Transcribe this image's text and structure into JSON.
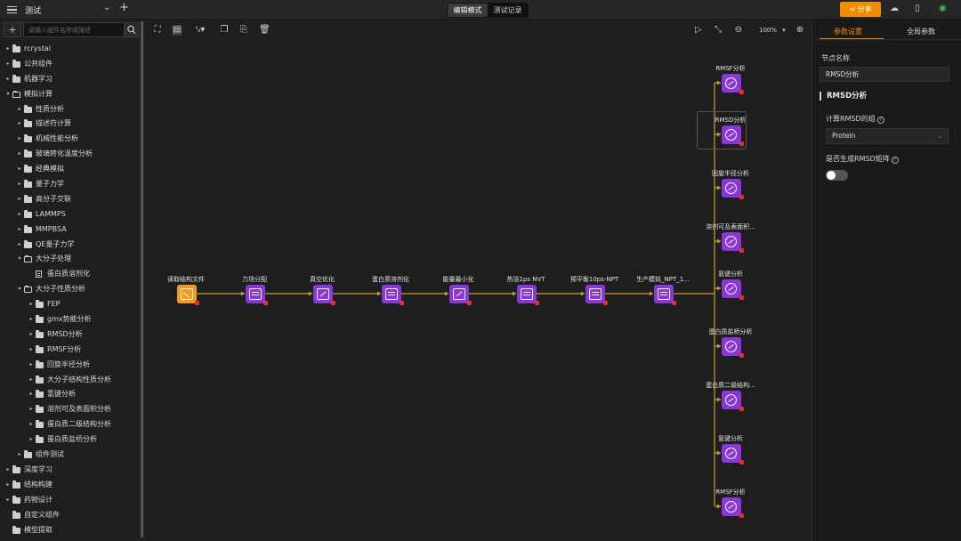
{
  "topbar": {
    "project_title": "测试",
    "modes": [
      {
        "label": "编辑模式",
        "active": true
      },
      {
        "label": "测试记录",
        "active": false
      }
    ],
    "share_label": "分享",
    "accent": "#f08c00"
  },
  "sidebar": {
    "search_placeholder": "请输入组件名称或描述",
    "tree": [
      {
        "label": "rcrystal",
        "depth": 0,
        "type": "folder",
        "expanded": false
      },
      {
        "label": "公共组件",
        "depth": 0,
        "type": "folder",
        "expanded": false
      },
      {
        "label": "机器学习",
        "depth": 0,
        "type": "folder",
        "expanded": false
      },
      {
        "label": "模拟计算",
        "depth": 0,
        "type": "folder",
        "expanded": true
      },
      {
        "label": "性质分析",
        "depth": 1,
        "type": "folder",
        "expanded": false
      },
      {
        "label": "描述符计算",
        "depth": 1,
        "type": "folder",
        "expanded": false
      },
      {
        "label": "机械性能分析",
        "depth": 1,
        "type": "folder",
        "expanded": false
      },
      {
        "label": "玻璃转化温度分析",
        "depth": 1,
        "type": "folder",
        "expanded": false
      },
      {
        "label": "经典模拟",
        "depth": 1,
        "type": "folder",
        "expanded": false
      },
      {
        "label": "量子力学",
        "depth": 1,
        "type": "folder",
        "expanded": false
      },
      {
        "label": "高分子交联",
        "depth": 1,
        "type": "folder",
        "expanded": false
      },
      {
        "label": "LAMMPS",
        "depth": 1,
        "type": "folder",
        "expanded": false
      },
      {
        "label": "MMPBSA",
        "depth": 1,
        "type": "folder",
        "expanded": false
      },
      {
        "label": "QE量子力学",
        "depth": 1,
        "type": "folder",
        "expanded": false
      },
      {
        "label": "大分子处理",
        "depth": 1,
        "type": "folder",
        "expanded": true
      },
      {
        "label": "蛋白质溶剂化",
        "depth": 2,
        "type": "file",
        "expanded": false
      },
      {
        "label": "大分子性质分析",
        "depth": 1,
        "type": "folder",
        "expanded": true
      },
      {
        "label": "FEP",
        "depth": 2,
        "type": "folder",
        "expanded": false
      },
      {
        "label": "gmx势能分析",
        "depth": 2,
        "type": "folder",
        "expanded": false
      },
      {
        "label": "RMSD分析",
        "depth": 2,
        "type": "folder",
        "expanded": false
      },
      {
        "label": "RMSF分析",
        "depth": 2,
        "type": "folder",
        "expanded": false
      },
      {
        "label": "回旋半径分析",
        "depth": 2,
        "type": "folder",
        "expanded": false
      },
      {
        "label": "大分子结构性质分析",
        "depth": 2,
        "type": "folder",
        "expanded": false
      },
      {
        "label": "氢键分析",
        "depth": 2,
        "type": "folder",
        "expanded": false
      },
      {
        "label": "溶剂可及表面积分析",
        "depth": 2,
        "type": "folder",
        "expanded": false
      },
      {
        "label": "蛋白质二级结构分析",
        "depth": 2,
        "type": "folder",
        "expanded": false
      },
      {
        "label": "蛋白质盐桥分析",
        "depth": 2,
        "type": "folder",
        "expanded": false
      },
      {
        "label": "组件测试",
        "depth": 1,
        "type": "folder",
        "expanded": false
      },
      {
        "label": "深度学习",
        "depth": 0,
        "type": "folder",
        "expanded": false
      },
      {
        "label": "结构构建",
        "depth": 0,
        "type": "folder",
        "expanded": false
      },
      {
        "label": "药物设计",
        "depth": 0,
        "type": "folder",
        "expanded": false
      },
      {
        "label": "自定义组件",
        "depth": 0,
        "type": "folder",
        "expanded": false,
        "no_caret": true
      },
      {
        "label": "模型提取",
        "depth": 0,
        "type": "folder",
        "expanded": false,
        "no_caret": true
      }
    ]
  },
  "canvas": {
    "zoom_label": "100%",
    "pipeline": [
      {
        "label": "读取结构文件",
        "icon": "image-icon",
        "color": "orange"
      },
      {
        "label": "力场分配",
        "icon": "grid-icon",
        "color": "purple"
      },
      {
        "label": "真空优化",
        "icon": "cube-icon",
        "color": "purple"
      },
      {
        "label": "蛋白质溶剂化",
        "icon": "grid-icon",
        "color": "purple"
      },
      {
        "label": "能量最小化",
        "icon": "cube-icon",
        "color": "purple"
      },
      {
        "label": "热浴1ps NVT",
        "icon": "grid-icon",
        "color": "purple"
      },
      {
        "label": "预平衡10ps-NPT",
        "icon": "grid-icon",
        "color": "purple"
      },
      {
        "label": "生产模拟_NPT_1...",
        "icon": "grid-icon",
        "color": "purple"
      }
    ],
    "branches": [
      {
        "label": "RMSF分析",
        "selected": false
      },
      {
        "label": "RMSD分析",
        "selected": true
      },
      {
        "label": "回旋半径分析",
        "selected": false
      },
      {
        "label": "溶剂可及表面积...",
        "selected": false
      },
      {
        "label": "氢键分析",
        "selected": false
      },
      {
        "label": "蛋白质盐桥分析",
        "selected": false
      },
      {
        "label": "蛋白质二级结构...",
        "selected": false
      },
      {
        "label": "氢键分析",
        "selected": false
      },
      {
        "label": "RMSF分析",
        "selected": false
      }
    ],
    "edge_color": "#c8a030",
    "node_purple": "#8a36d8",
    "node_orange": "#f59a1c",
    "error_color": "#e03030"
  },
  "panel": {
    "tabs": [
      {
        "label": "参数设置",
        "active": true
      },
      {
        "label": "全局参数",
        "active": false
      }
    ],
    "node_name_label": "节点名称",
    "node_name_value": "RMSD分析",
    "section_title": "RMSD分析",
    "group_label": "计算RMSD的组",
    "group_value": "Protein",
    "matrix_label": "是否生成RMSD矩阵",
    "matrix_enabled": false
  }
}
